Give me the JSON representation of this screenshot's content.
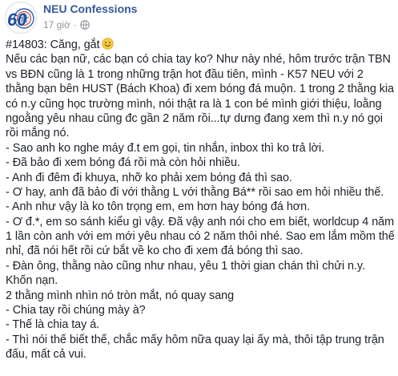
{
  "page": {
    "name": "NEU Confessions",
    "avatar_text": "60",
    "timestamp": "17 giờ",
    "separator": "·",
    "privacy_icon": "globe-icon"
  },
  "post": {
    "first_line": "#14803: Căng, gắt",
    "emoji_icon": "smile-emoji-icon",
    "lines": [
      "Nếu các bạn nữ, các bạn có chia tay ko? Như này nhé, hôm trước trận TBN",
      "vs BĐN cũng là 1 trong những trận hot đầu tiên, mình - K57 NEU với 2",
      "thằng bạn bên HUST (Bách Khoa) đi xem bóng đá muộn. 1 trong 2 thằng kia",
      "có n.y cũng học trường mình, nói thật ra là 1 con bé mình giới thiệu, loằng",
      "ngoằng yêu nhau cũng đc gần 2 năm rồi...tự dưng đang xem thì n.y nó gọi",
      "rồi mắng nó.",
      "- Sao anh ko nghe máy đ.t em gọi, tin nhắn, inbox thì ko trả lời.",
      "- Đã bảo đi xem bóng đá rồi mà còn hỏi nhiều.",
      "- Anh đi đêm đi khuya, nhỡ ko phải xem bóng đá thì sao.",
      "- Ơ hay, anh đã bảo đi với thằng L với thằng Bá** rồi sao em hỏi nhiều thế.",
      "- Anh như vậy là ko tôn trọng em, em hơn hay bóng đá hơn.",
      "- Ơ đ.*, em so sánh kiểu gì vậy. Đã vậy anh nói cho em biết, worldcup 4 năm",
      "1 lần còn anh với em mới yêu nhau có 2 năm thôi nhé. Sao em lắm mồm thế",
      "nhỉ, đã nói hết rồi cứ bắt về ko cho đi xem đá bóng thì sao.",
      "- Đàn ông, thằng nào cũng như nhau, yêu 1 thời gian chán thì chửi n.y.",
      "Khốn nạn.",
      "2 thằng mình nhìn nó tròn mắt, nó quay sang",
      "- Chia tay rồi chúng mày à?",
      "- Thế là chia tay á.",
      "- Thì nói thế biết thế, chắc mấy hôm nữa quay lại ấy mà, thôi tập trung trận",
      "đấu, mất cả vui."
    ]
  },
  "colors": {
    "page_name": "#385898",
    "body_text": "#1d2129",
    "meta_text": "#90949c",
    "avatar_ring": "#2f5fa8",
    "avatar_number": "#1f4f99",
    "emoji_face": "#f7c844"
  }
}
